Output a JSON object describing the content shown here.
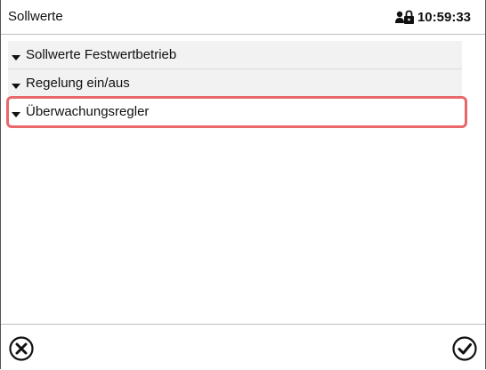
{
  "header": {
    "title": "Sollwerte",
    "time": "10:59:33",
    "lock_icon": "user-lock-icon"
  },
  "menu": {
    "items": [
      {
        "label": "Sollwerte Festwertbetrieb"
      },
      {
        "label": "Regelung ein/aus"
      },
      {
        "label": "Überwachungsregler",
        "highlighted": true
      }
    ]
  },
  "footer": {
    "cancel_icon": "circle-x-icon",
    "confirm_icon": "circle-check-icon"
  },
  "colors": {
    "highlight": "#e8686c",
    "item_bg": "#f2f2f2"
  }
}
